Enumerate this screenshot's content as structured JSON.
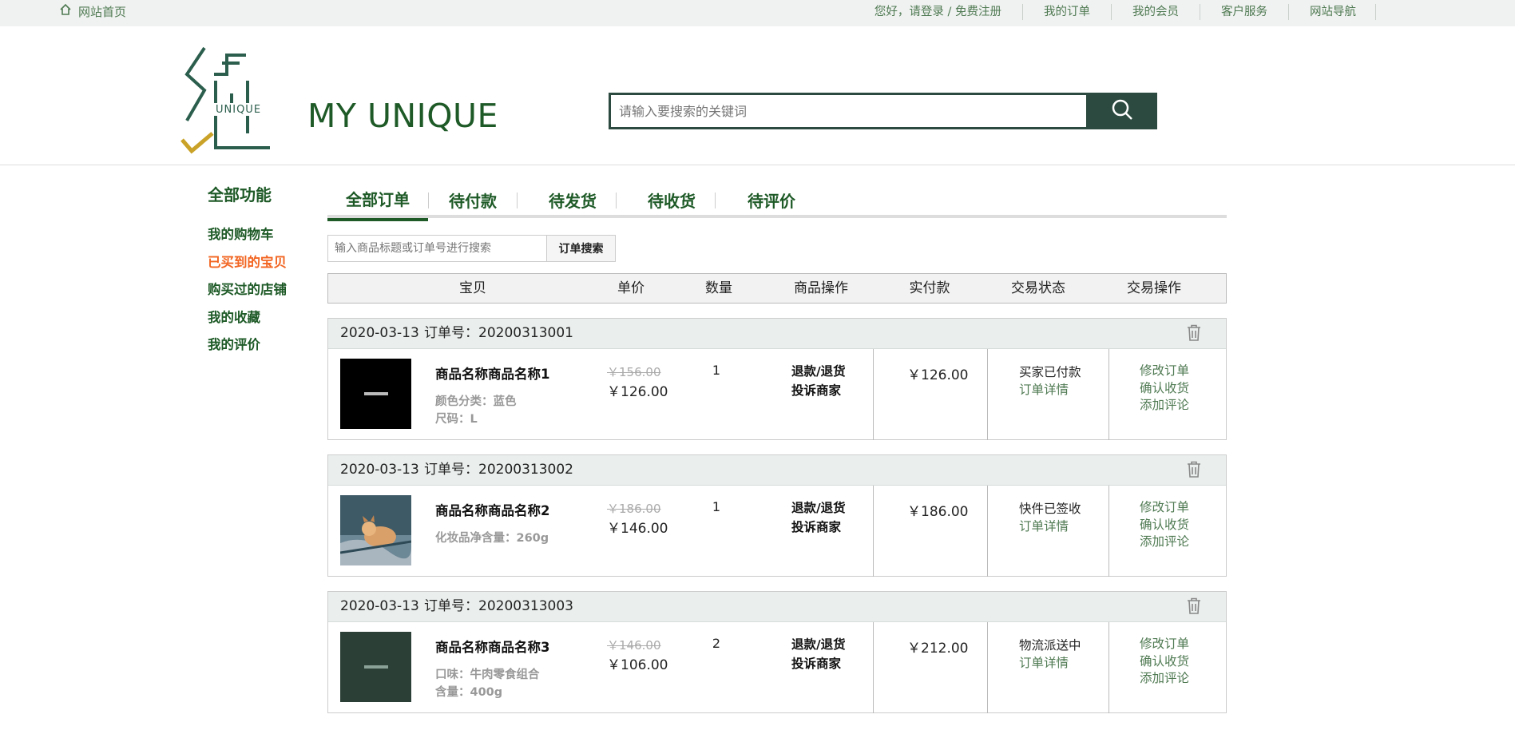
{
  "topbar": {
    "home_label": "网站首页",
    "links": [
      "您好，请登录 / 免费注册",
      "我的订单",
      "我的会员",
      "客户服务",
      "网站导航"
    ]
  },
  "header": {
    "logo_char": "绝",
    "logo_sub": "UNIQUE",
    "brand": "MY UNIQUE",
    "search_placeholder": "请输入要搜索的关键词",
    "accent_color": "#2c4a3f"
  },
  "sidebar": {
    "title": "全部功能",
    "items": [
      {
        "label": "我的购物车",
        "active": false
      },
      {
        "label": "已买到的宝贝",
        "active": true
      },
      {
        "label": "购买过的店铺",
        "active": false
      },
      {
        "label": "我的收藏",
        "active": false
      },
      {
        "label": "我的评价",
        "active": false
      }
    ]
  },
  "tabs": [
    {
      "label": "全部订单",
      "active": true
    },
    {
      "label": "待付款",
      "active": false
    },
    {
      "label": "待发货",
      "active": false
    },
    {
      "label": "待收货",
      "active": false
    },
    {
      "label": "待评价",
      "active": false
    }
  ],
  "order_search": {
    "placeholder": "输入商品标题或订单号进行搜索",
    "button": "订单搜索"
  },
  "table_headers": [
    "宝贝",
    "单价",
    "数量",
    "商品操作",
    "实付款",
    "交易状态",
    "交易操作"
  ],
  "orders": [
    {
      "date": "2020-03-13",
      "order_no": "订单号：20200313001",
      "product_name": "商品名称商品名称1",
      "attrs": [
        "颜色分类：蓝色",
        "尺码：L"
      ],
      "old_price": "￥156.00",
      "new_price": "￥126.00",
      "qty": "1",
      "ops": [
        "退款/退货",
        "投诉商家"
      ],
      "paid": "￥126.00",
      "status": "买家已付款",
      "status_link": "订单详情",
      "actions": [
        "修改订单",
        "确认收货",
        "添加评论"
      ]
    },
    {
      "date": "2020-03-13",
      "order_no": "订单号：20200313002",
      "product_name": "商品名称商品名称2",
      "attrs": [
        "化妆品净含量：260g"
      ],
      "old_price": "￥186.00",
      "new_price": "￥146.00",
      "qty": "1",
      "ops": [
        "退款/退货",
        "投诉商家"
      ],
      "paid": "￥186.00",
      "status": "快件已签收",
      "status_link": "订单详情",
      "actions": [
        "修改订单",
        "确认收货",
        "添加评论"
      ]
    },
    {
      "date": "2020-03-13",
      "order_no": "订单号：20200313003",
      "product_name": "商品名称商品名称3",
      "attrs": [
        "口味：牛肉零食组合",
        "含量：400g"
      ],
      "old_price": "￥146.00",
      "new_price": "￥106.00",
      "qty": "2",
      "ops": [
        "退款/退货",
        "投诉商家"
      ],
      "paid": "￥212.00",
      "status": "物流派送中",
      "status_link": "订单详情",
      "actions": [
        "修改订单",
        "确认收货",
        "添加评论"
      ]
    }
  ],
  "icons": {
    "home": "home-icon",
    "search": "search-icon",
    "trash": "trash-icon"
  }
}
